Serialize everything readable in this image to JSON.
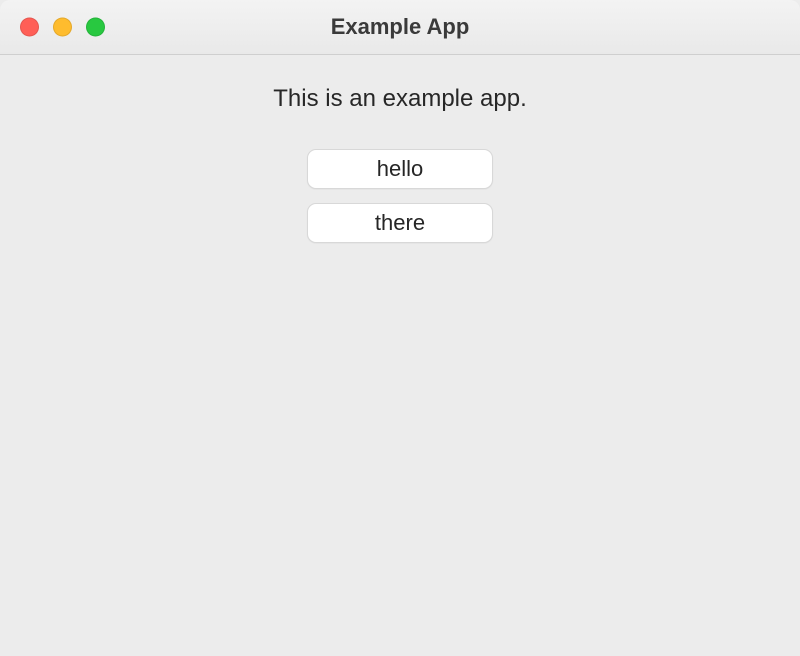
{
  "window": {
    "title": "Example App"
  },
  "content": {
    "label": "This is an example app."
  },
  "buttons": {
    "first": "hello",
    "second": "there"
  }
}
